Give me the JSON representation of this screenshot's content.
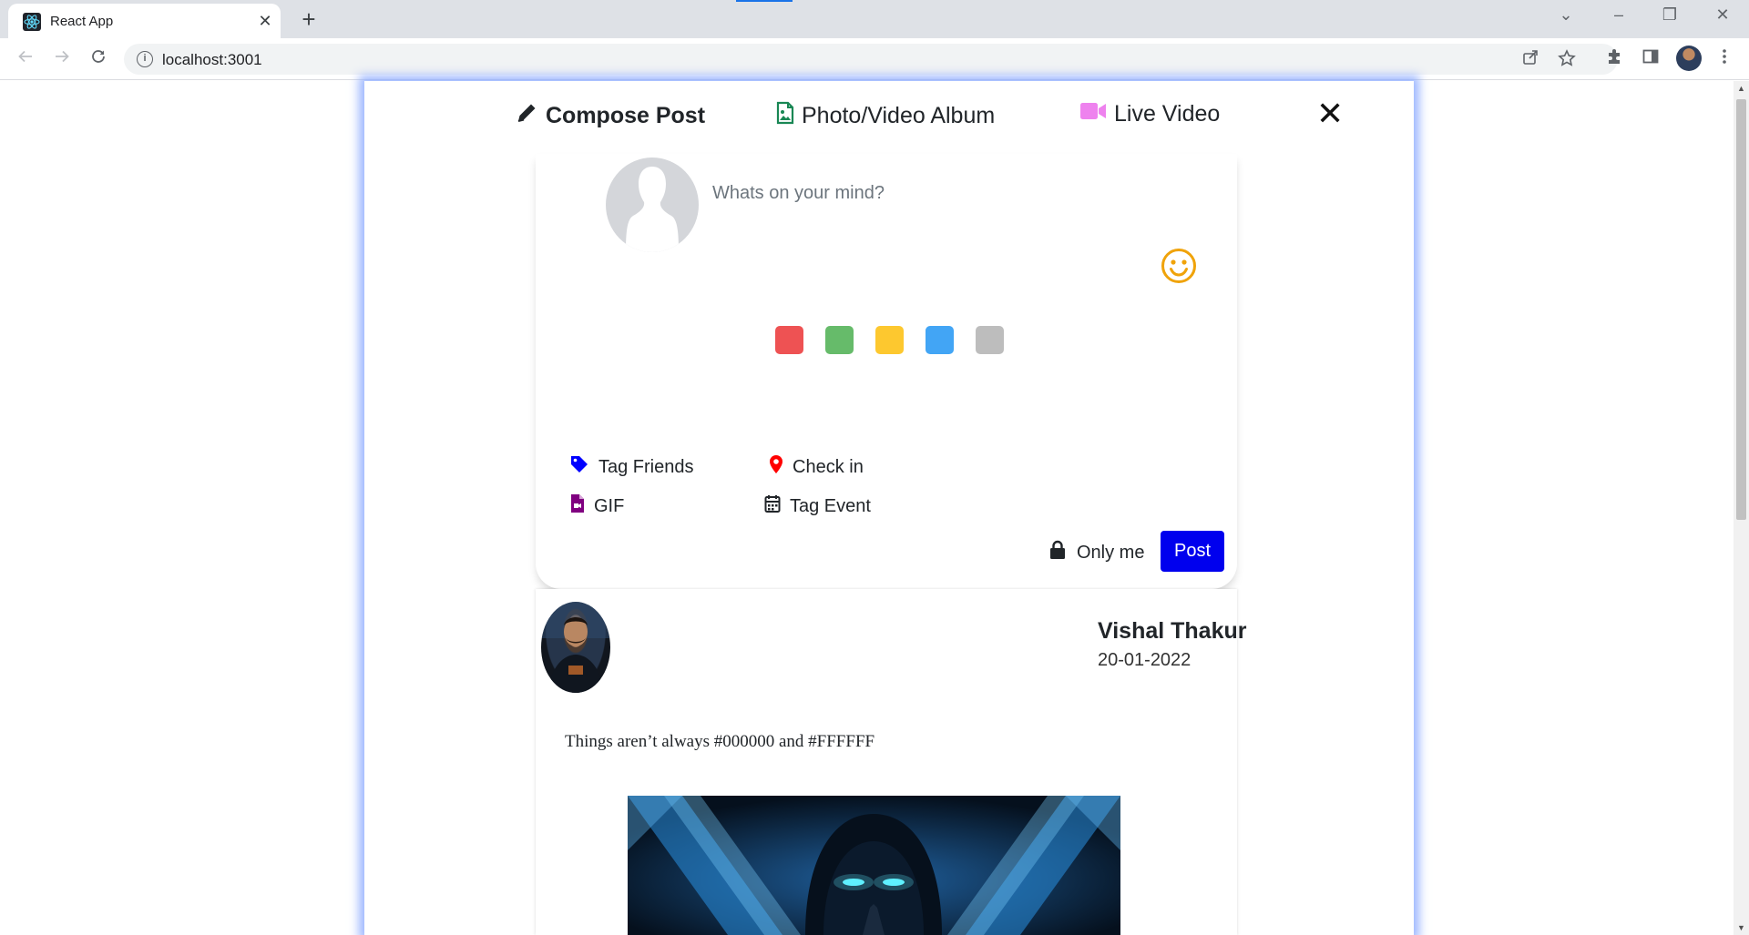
{
  "browser": {
    "tab_title": "React App",
    "tab_close": "✕",
    "new_tab": "+",
    "url": "localhost:3001",
    "window_controls": {
      "dropdown": "⌄",
      "minimize": "–",
      "restore": "❐",
      "close": "✕"
    },
    "icons": [
      "back-arrow-icon",
      "forward-arrow-icon",
      "reload-icon",
      "site-info-icon",
      "share-icon",
      "bookmark-star-icon",
      "extensions-icon",
      "side-panel-icon",
      "profile-avatar",
      "menu-dots-icon"
    ]
  },
  "modal": {
    "tabs": [
      {
        "label": "Compose Post",
        "icon": "pencil-icon",
        "color": "#212529"
      },
      {
        "label": "Photo/Video Album",
        "icon": "file-image-icon",
        "color": "#198754"
      },
      {
        "label": "Live Video",
        "icon": "video-camera-icon",
        "color": "#ee82ee"
      }
    ],
    "close_label": "✕"
  },
  "compose": {
    "placeholder": "Whats on your mind?",
    "emoji_color": "#f0a30a",
    "swatches": [
      {
        "name": "red",
        "color": "#ee5253"
      },
      {
        "name": "green",
        "color": "#66bb6a"
      },
      {
        "name": "yellow",
        "color": "#fdc82f"
      },
      {
        "name": "blue",
        "color": "#42a5f5"
      },
      {
        "name": "gray",
        "color": "#bdbdbd"
      }
    ],
    "options": [
      {
        "label": "Tag Friends",
        "icon": "tag-icon",
        "color": "#0000ff"
      },
      {
        "label": "Check in",
        "icon": "map-pin-icon",
        "color": "#ff0000"
      },
      {
        "label": "GIF",
        "icon": "file-video-icon",
        "color": "#800080"
      },
      {
        "label": "Tag Event",
        "icon": "calendar-icon",
        "color": "#212529"
      }
    ],
    "privacy_label": "Only me",
    "post_label": "Post",
    "post_color": "#0000ee"
  },
  "post": {
    "author": "Vishal Thakur",
    "date": "20-01-2022",
    "text": "Things aren’t always #000000 and #FFFFFF"
  }
}
